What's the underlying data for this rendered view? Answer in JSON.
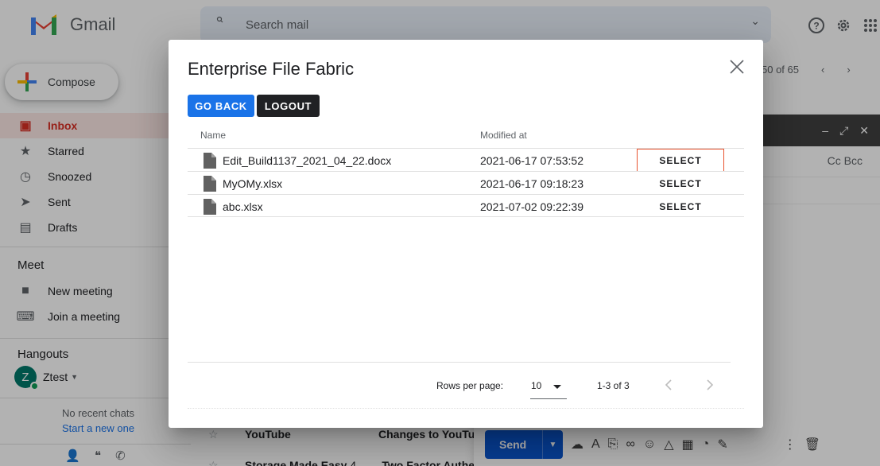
{
  "gmail": {
    "brand": "Gmail",
    "search_placeholder": "Search mail",
    "compose_label": "Compose",
    "nav": [
      {
        "label": "Inbox",
        "icon": "inbox-icon",
        "active": true
      },
      {
        "label": "Starred",
        "icon": "star-icon"
      },
      {
        "label": "Snoozed",
        "icon": "clock-icon"
      },
      {
        "label": "Sent",
        "icon": "send-icon"
      },
      {
        "label": "Drafts",
        "icon": "draft-icon"
      }
    ],
    "meet": {
      "title": "Meet",
      "items": [
        {
          "label": "New meeting",
          "icon": "video-icon"
        },
        {
          "label": "Join a meeting",
          "icon": "keyboard-icon"
        }
      ]
    },
    "hangouts": {
      "title": "Hangouts",
      "user_initial": "Z",
      "user_name": "Ztest",
      "no_chats": "No recent chats",
      "start_new": "Start a new one"
    },
    "pager": "50 of 65",
    "mail_rows": [
      {
        "sender": "YouTube",
        "subject": "Changes to YouTu"
      },
      {
        "sender": "Storage Made Easy",
        "count": "4",
        "subject": "Two Factor Auther"
      }
    ],
    "compose_window": {
      "cc_bcc": "Cc Bcc",
      "send_label": "Send"
    }
  },
  "modal": {
    "title": "Enterprise File Fabric",
    "go_back_label": "GO BACK",
    "logout_label": "LOGOUT",
    "columns": {
      "name": "Name",
      "modified": "Modified at"
    },
    "files": [
      {
        "name": "Edit_Build1137_2021_04_22.docx",
        "modified": "2021-06-17 07:53:52",
        "action": "SELECT"
      },
      {
        "name": "MyOMy.xlsx",
        "modified": "2021-06-17 09:18:23",
        "action": "SELECT"
      },
      {
        "name": "abc.xlsx",
        "modified": "2021-07-02 09:22:39",
        "action": "SELECT"
      }
    ],
    "pagination": {
      "rows_per_page_label": "Rows per page:",
      "rows_per_page": "10",
      "range": "1-3 of 3"
    }
  },
  "colors": {
    "primary": "#1a73e8",
    "dark": "#202124",
    "highlight": "#e8542f",
    "inbox_active": "#d93025"
  }
}
